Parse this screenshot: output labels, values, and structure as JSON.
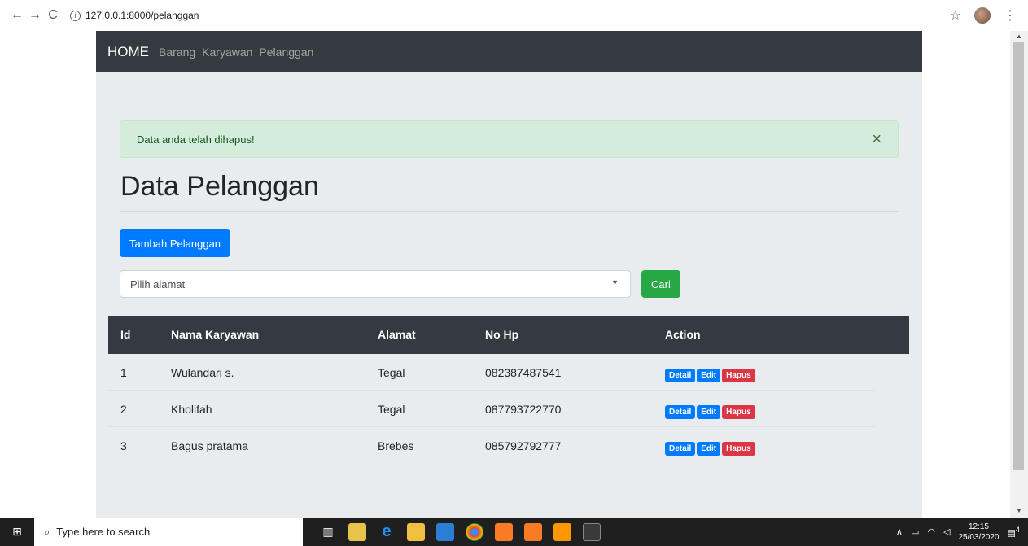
{
  "browser": {
    "back": "←",
    "forward": "→",
    "reload": "C",
    "info_icon": "i",
    "url": "127.0.0.1:8000/pelanggan",
    "star": "☆",
    "menu": "⋮"
  },
  "navbar": {
    "brand": "HOME",
    "links": [
      "Barang",
      "Karyawan",
      "Pelanggan"
    ]
  },
  "alert": {
    "message": "Data anda telah dihapus!",
    "close": "×"
  },
  "page": {
    "title": "Data Pelanggan",
    "add_button": "Tambah Pelanggan",
    "select_placeholder": "Pilih alamat",
    "select_caret": "▼",
    "search_button": "Cari"
  },
  "table": {
    "headers": [
      "Id",
      "Nama Karyawan",
      "Alamat",
      "No Hp",
      "Action"
    ],
    "rows": [
      {
        "id": "1",
        "nama": "Wulandari s.",
        "alamat": "Tegal",
        "nohp": "082387487541"
      },
      {
        "id": "2",
        "nama": "Kholifah",
        "alamat": "Tegal",
        "nohp": "087793722770"
      },
      {
        "id": "3",
        "nama": "Bagus pratama",
        "alamat": "Brebes",
        "nohp": "085792792777"
      }
    ],
    "actions": {
      "detail": "Detail",
      "edit": "Edit",
      "hapus": "Hapus"
    }
  },
  "taskbar": {
    "start": "⊞",
    "search_icon": "⌕",
    "search_placeholder": "Type here to search",
    "time": "12:15",
    "date": "25/03/2020",
    "notifications": "4"
  },
  "colors": {
    "navbar": "#343a40",
    "primary": "#007bff",
    "success": "#28a745",
    "danger": "#dc3545",
    "alert_bg": "#d4edda"
  }
}
